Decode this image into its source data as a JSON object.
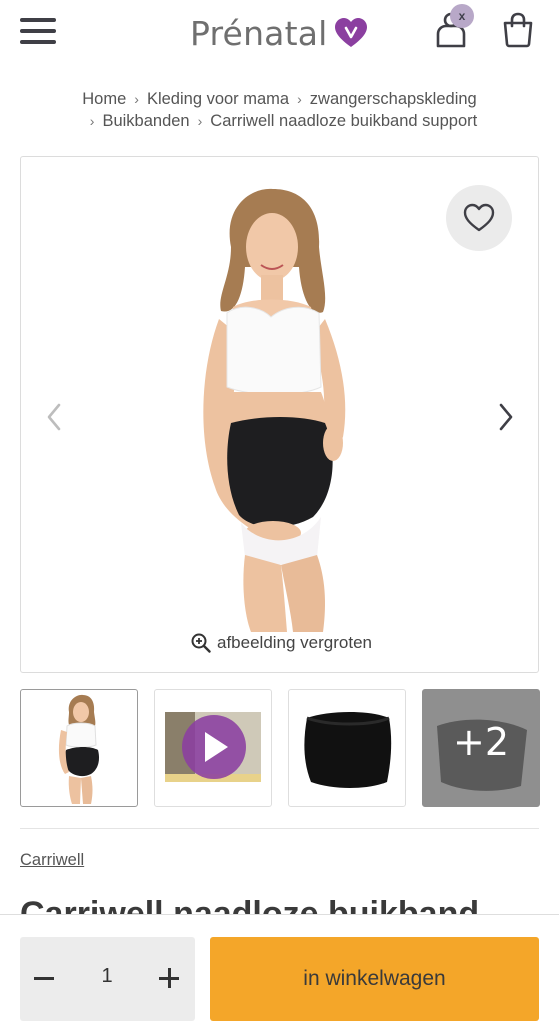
{
  "header": {
    "logo_text": "Prénatal",
    "account_badge": "x",
    "brand_color": "#8b3fa0"
  },
  "breadcrumb": {
    "items": [
      "Home",
      "Kleding voor mama",
      "zwangerschapskleding",
      "Buikbanden",
      "Carriwell naadloze buikband support"
    ],
    "separator": "›"
  },
  "gallery": {
    "zoom_label": "afbeelding vergroten",
    "more_label": "+2"
  },
  "product": {
    "brand": "Carriwell",
    "title": "Carriwell naadloze buikband"
  },
  "purchase": {
    "quantity": "1",
    "add_to_cart_label": "in winkelwagen",
    "accent_color": "#f4a629"
  },
  "icons": [
    "menu-icon",
    "heart-logo-icon",
    "account-icon",
    "cart-icon",
    "heart-icon",
    "chevron-left-icon",
    "chevron-right-icon",
    "zoom-in-icon",
    "play-icon",
    "minus-icon",
    "plus-icon"
  ]
}
